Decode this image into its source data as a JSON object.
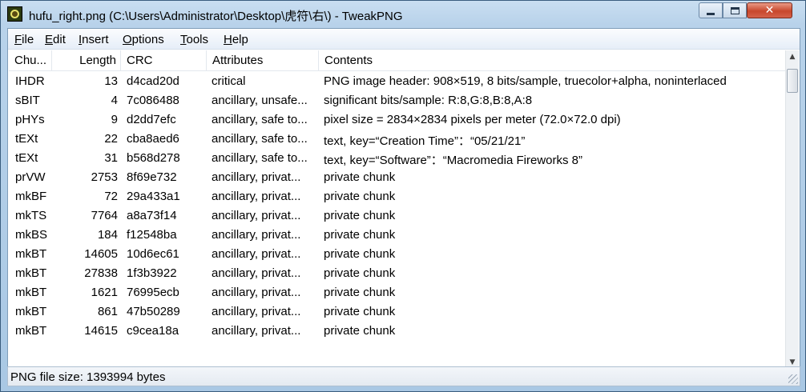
{
  "window": {
    "title": "hufu_right.png (C:\\Users\\Administrator\\Desktop\\虎符\\右\\) - TweakPNG",
    "app_icon": "tweakpng-app-icon",
    "controls": {
      "minimize": "minimize-icon",
      "maximize": "maximize-icon",
      "close": "close-icon",
      "close_glyph": "✕"
    }
  },
  "menu": [
    {
      "label": "File",
      "accel": "F"
    },
    {
      "label": "Edit",
      "accel": "E"
    },
    {
      "label": "Insert",
      "accel": "I"
    },
    {
      "label": "Options",
      "accel": "O"
    },
    {
      "label": "Tools",
      "accel": "T"
    },
    {
      "label": "Help",
      "accel": "H"
    }
  ],
  "table": {
    "columns": [
      "Chu...",
      "Length",
      "CRC",
      "Attributes",
      "Contents"
    ],
    "rows": [
      {
        "chunk": "IHDR",
        "length": "13",
        "crc": "d4cad20d",
        "attributes": "critical",
        "contents": "PNG image header: 908×519, 8 bits/sample, truecolor+alpha, noninterlaced"
      },
      {
        "chunk": "sBIT",
        "length": "4",
        "crc": "7c086488",
        "attributes": "ancillary, unsafe...",
        "contents": "significant bits/sample: R:8,G:8,B:8,A:8"
      },
      {
        "chunk": "pHYs",
        "length": "9",
        "crc": "d2dd7efc",
        "attributes": "ancillary, safe to...",
        "contents": "pixel size = 2834×2834 pixels per meter (72.0×72.0 dpi)"
      },
      {
        "chunk": "tEXt",
        "length": "22",
        "crc": "cba8aed6",
        "attributes": "ancillary, safe to...",
        "contents": "text, key=“Creation Time”：“05/21/21”"
      },
      {
        "chunk": "tEXt",
        "length": "31",
        "crc": "b568d278",
        "attributes": "ancillary, safe to...",
        "contents": "text, key=“Software”：“Macromedia Fireworks 8”"
      },
      {
        "chunk": "prVW",
        "length": "2753",
        "crc": "8f69e732",
        "attributes": "ancillary, privat...",
        "contents": "private chunk"
      },
      {
        "chunk": "mkBF",
        "length": "72",
        "crc": "29a433a1",
        "attributes": "ancillary, privat...",
        "contents": "private chunk"
      },
      {
        "chunk": "mkTS",
        "length": "7764",
        "crc": "a8a73f14",
        "attributes": "ancillary, privat...",
        "contents": "private chunk"
      },
      {
        "chunk": "mkBS",
        "length": "184",
        "crc": "f12548ba",
        "attributes": "ancillary, privat...",
        "contents": "private chunk"
      },
      {
        "chunk": "mkBT",
        "length": "14605",
        "crc": "10d6ec61",
        "attributes": "ancillary, privat...",
        "contents": "private chunk"
      },
      {
        "chunk": "mkBT",
        "length": "27838",
        "crc": "1f3b3922",
        "attributes": "ancillary, privat...",
        "contents": "private chunk"
      },
      {
        "chunk": "mkBT",
        "length": "1621",
        "crc": "76995ecb",
        "attributes": "ancillary, privat...",
        "contents": "private chunk"
      },
      {
        "chunk": "mkBT",
        "length": "861",
        "crc": "47b50289",
        "attributes": "ancillary, privat...",
        "contents": "private chunk"
      },
      {
        "chunk": "mkBT",
        "length": "14615",
        "crc": "c9cea18a",
        "attributes": "ancillary, privat...",
        "contents": "private chunk"
      }
    ]
  },
  "scrollbars": {
    "up_icon": "▲",
    "down_icon": "▼",
    "left_icon": "◀",
    "right_icon": "▶",
    "grip": "|||"
  },
  "status": {
    "text": "PNG file size: 1393994 bytes"
  }
}
